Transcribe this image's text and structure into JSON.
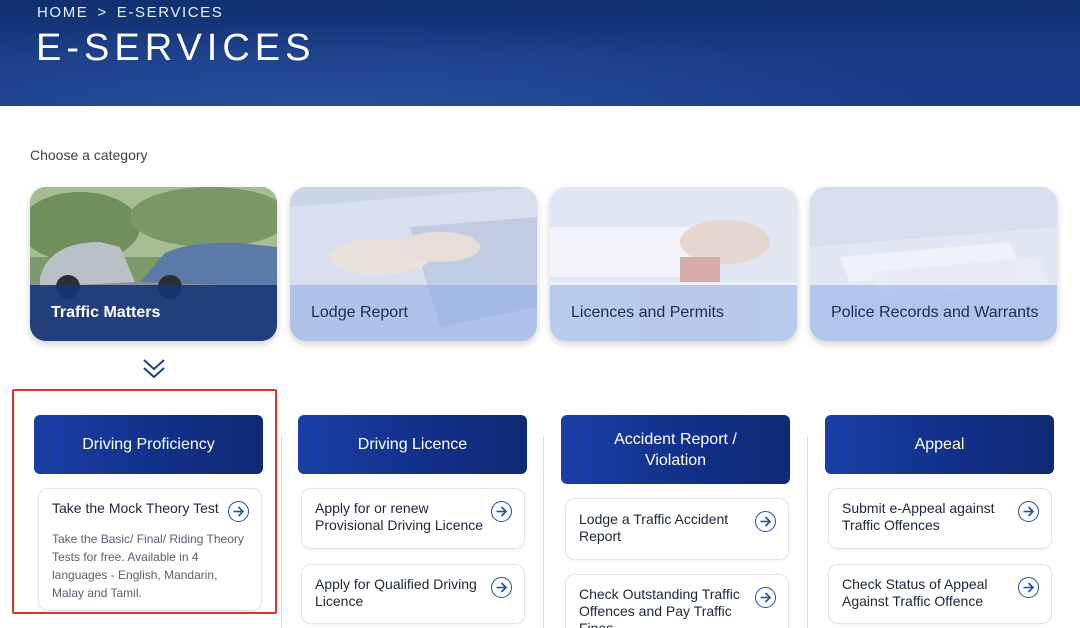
{
  "breadcrumb": {
    "home": "HOME",
    "separator": ">",
    "current": "E-SERVICES"
  },
  "page_title": "E-SERVICES",
  "choose_label": "Choose a category",
  "categories": [
    {
      "label": "Traffic Matters",
      "active": true
    },
    {
      "label": "Lodge Report",
      "active": false
    },
    {
      "label": "Licences and Permits",
      "active": false
    },
    {
      "label": "Police Records and Warrants",
      "active": false
    }
  ],
  "columns": [
    {
      "header": "Driving Proficiency",
      "cards": [
        {
          "title": "Take the Mock Theory Test",
          "desc": "Take the Basic/ Final/ Riding Theory Tests for free. Available in 4 languages - English, Mandarin, Malay and Tamil."
        }
      ]
    },
    {
      "header": "Driving Licence",
      "cards": [
        {
          "title": "Apply for or renew Provisional Driving Licence"
        },
        {
          "title": "Apply for Qualified Driving Licence"
        }
      ]
    },
    {
      "header": "Accident Report / Violation",
      "cards": [
        {
          "title": "Lodge a Traffic Accident Report"
        },
        {
          "title": "Check Outstanding Traffic Offences and Pay Traffic Fines"
        }
      ]
    },
    {
      "header": "Appeal",
      "cards": [
        {
          "title": "Submit e-Appeal against Traffic Offences"
        },
        {
          "title": "Check Status of Appeal Against Traffic Offence"
        }
      ]
    }
  ],
  "colors": {
    "header_bg": "#10306e",
    "accent": "#1f4bb3",
    "highlight_border": "#e0332d"
  },
  "icons": {
    "chevron": "double-chevron-down-icon",
    "arrow": "arrow-right-circle-icon"
  }
}
